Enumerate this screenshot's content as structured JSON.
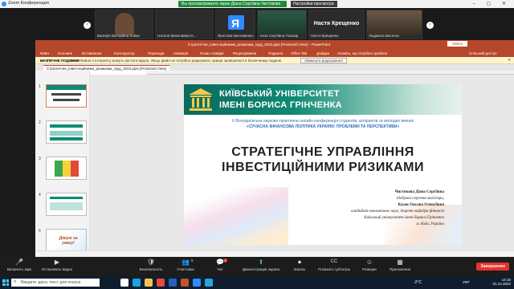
{
  "zoom": {
    "window_title": "Zoom Конференция",
    "share_banner": "Вы просматриваете экран Діана Сергіївна Чистякова",
    "share_settings": "Настройки просмотра ▾",
    "window_controls": "– ▢ ✕"
  },
  "gallery": {
    "prev_arrow": "‹",
    "next_arrow": "›",
    "participants": [
      {
        "name": "Валерія Вікторівна Лойко",
        "initial": "",
        "color": "#7a5a40"
      },
      {
        "name": "Наталя Миколаївна К...",
        "initial": "",
        "color": "#2b2b2b"
      },
      {
        "name": "Ярослав Мисливенко",
        "initial": "Я",
        "color": "#2d8cff"
      },
      {
        "name": "Анна Сергіївна Псюкар",
        "initial": "",
        "color": "#2f6b4a"
      },
      {
        "name": "Настя Крещенко",
        "initial": "Настя Крещенко",
        "color": "#2b2b2b"
      },
      {
        "name": "Людмила Васенко",
        "initial": "",
        "color": "#5a4a3a"
      }
    ]
  },
  "ppt": {
    "window_title": "Стратегічне_інвестиційними_ризиками_груд_2022.pptx [Protected View] – PowerPoint",
    "signin": "Увійти",
    "ribbon_tabs": [
      "Файл",
      "Основне",
      "Вставлення",
      "Конструктор",
      "Переходи",
      "Анімація",
      "Показ слайдів",
      "Рецензування",
      "Подання",
      "Office Tab",
      "Довідка",
      "Скажіть, що потрібно зробити"
    ],
    "share": "Спільний доступ",
    "protected_label": "БЕЗПЕЧНЕ ПОДАННЯ",
    "protected_msg": "Увага! Файли з Інтернету можуть містити віруси. Якщо файл не потрібно редагувати, краще залишатися в безпечному поданні.",
    "enable_edit": "Увімкнути редагування",
    "close_bar": "✕",
    "doc_tab": "Стратегічне_інвестиційними_ризиками_груд_2022.pptx [Protected View]",
    "slide_numbers": [
      "1",
      "2",
      "3",
      "4",
      "5"
    ],
    "thumb5_text": "Дякую за увагу!"
  },
  "slide": {
    "uni_line1": "КИЇВСЬКИЙ УНІВЕРСИТЕТ",
    "uni_line2": "ІМЕНІ БОРИСА ГРІНЧЕНКА",
    "conf_line1": "X Всеукраїнська науково-практична онлайн конференція студентів, аспірантів та молодих вчених",
    "conf_line2": "«СУЧАСНА ФІНАНСОВА ПОЛІТИКА УКРАЇНИ: ПРОБЛЕМИ ТА ПЕРСПЕКТИВИ»",
    "title1": "СТРАТЕГІЧНЕ УПРАВЛІННЯ",
    "title2": "ІНВЕСТИЦІЙНИМИ РИЗИКАМИ",
    "author1": "Чистякова Діана Сергіївна",
    "author1_role": "здобувач ступеня магістра,",
    "author2": "Казак Оксана Олексіївна",
    "author2_role": "кандидат економічних наук, доцент кафедри фінансів",
    "affiliation": "Київський університет імені Бориса Грінченка",
    "city": "м. Київ, Україна"
  },
  "meeting": {
    "controls": [
      {
        "label": "Включить звук",
        "icon": "🎤"
      },
      {
        "label": "Остановить видео",
        "icon": "▶"
      },
      {
        "label": "Безопасность",
        "icon": "🛡"
      },
      {
        "label": "Участники",
        "icon": "👥"
      },
      {
        "label": "Чат",
        "icon": "💬"
      },
      {
        "label": "Демонстрация экрана",
        "icon": "⬆"
      },
      {
        "label": "Запись",
        "icon": "⏺"
      },
      {
        "label": "Показать субтитры",
        "icon": "CC"
      },
      {
        "label": "Реакции",
        "icon": "☺"
      },
      {
        "label": "Приложения",
        "icon": "▦"
      }
    ],
    "participants_count": "5",
    "chat_badge": "2",
    "end": "Завершение"
  },
  "taskbar": {
    "search_placeholder": "Введите здесь текст для поиска",
    "weather": "-2°C",
    "lang": "УКР",
    "time": "14:15",
    "date": "01.12.2022",
    "apps": [
      {
        "name": "task-view-icon",
        "color": "#ffffff"
      },
      {
        "name": "edge-icon",
        "color": "#1fa1e0"
      },
      {
        "name": "explorer-icon",
        "color": "#f2c14e"
      },
      {
        "name": "chrome-icon",
        "color": "#e84a3c"
      },
      {
        "name": "word-icon",
        "color": "#2b5eb8"
      },
      {
        "name": "powerpoint-icon",
        "color": "#c6512c"
      },
      {
        "name": "zoom-icon",
        "color": "#2d8cff"
      },
      {
        "name": "telegram-icon",
        "color": "#2aa2de"
      }
    ]
  }
}
